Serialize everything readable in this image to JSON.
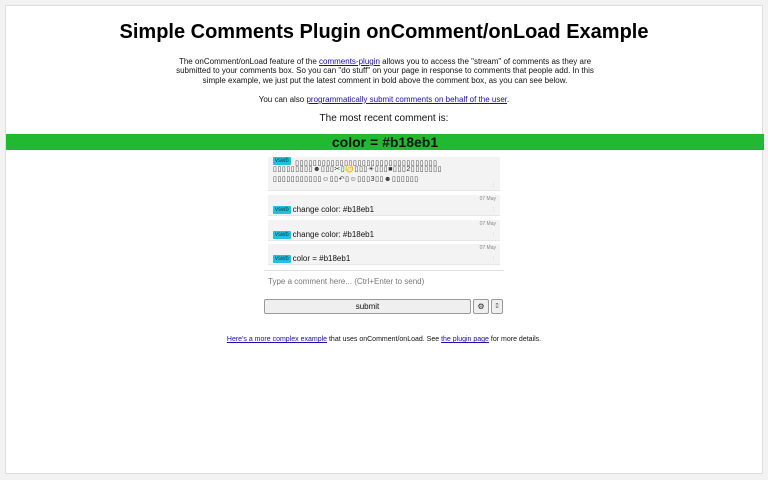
{
  "title": "Simple Comments Plugin onComment/onLoad Example",
  "intro": {
    "before_link": "The onComment/onLoad feature of the ",
    "link": "comments-plugin",
    "after_link": " allows you to access the \"stream\" of comments as they are submitted to your comments box. So you can \"do stuff\" on your page in response to comments that people add. In this simple example, we just put the latest comment in bold above the comment box, as you can see below."
  },
  "also": {
    "before_link": "You can also ",
    "link": "programmatically submit comments on behalf of the user",
    "after_link": "."
  },
  "recent_label": "The most recent comment is:",
  "banner": {
    "text": "color = #b18eb1",
    "color": "#21b832"
  },
  "comments": [
    {
      "user": "vswb",
      "line1": "▯▯▯▯▯▯▯▯▯▯▯▯▯▯▯▯▯▯▯▯▯▯▯▯▯▯▯▯▯▯▯▯",
      "line2": "▯▯▯▯▯▯▯▯▯☻▯▯▯✂▯♋▯▯▯☀▯▯▯■▯▯▯2▯▯▯▯▯▯▯",
      "line3": "▯▯▯▯▯▯▯▯▯▯▯☺▯▯↶▯☺▯▯▯3▯▯☻▯▯▯▯▯▯"
    },
    {
      "user": "vswb",
      "text": "change color: #b18eb1",
      "date": "07 May"
    },
    {
      "user": "vswb",
      "text": "change color: #b18eb1",
      "date": "07 May"
    },
    {
      "user": "vswb",
      "text": "color = #b18eb1",
      "date": "07 May"
    }
  ],
  "input": {
    "placeholder": "Type a comment here... (Ctrl+Enter to send)"
  },
  "buttons": {
    "submit": "submit",
    "settings_icon": "gear-icon",
    "extra_icon": "box-icon"
  },
  "footer": {
    "link1": "Here's a more complex example",
    "middle": " that uses onComment/onLoad. See ",
    "link2": "the plugin page",
    "end": " for more details."
  },
  "colors": {
    "user_badge": "#21c0dc",
    "link": "#1a0dab"
  }
}
